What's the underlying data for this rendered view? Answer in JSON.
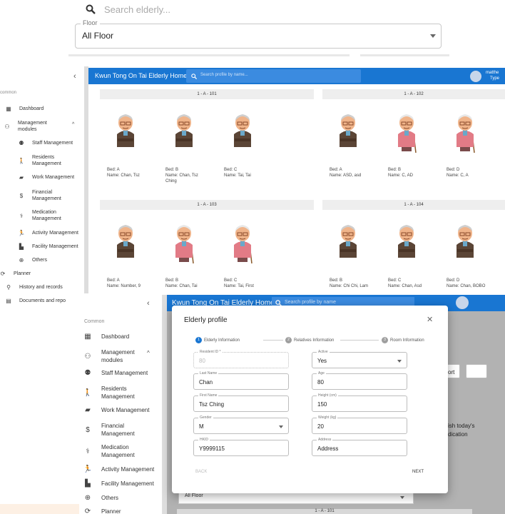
{
  "panel1": {
    "search_placeholder": "Search elderly...",
    "floor_label": "Floor",
    "floor_value": "All Floor"
  },
  "panel2": {
    "collapse_icon": "chevron-left-icon",
    "section_label": "common",
    "sidebar": [
      {
        "icon": "dashboard-icon",
        "glyph": "▦",
        "label": "Dashboard"
      },
      {
        "icon": "people-icon",
        "glyph": "⚇",
        "label": "Management\nmodules",
        "expand": "^"
      },
      {
        "icon": "staff-icon",
        "glyph": "⚉",
        "label": "Staff Management"
      },
      {
        "icon": "walking-icon",
        "glyph": "🚶",
        "label": "Residents\nManagement"
      },
      {
        "icon": "briefcase-icon",
        "glyph": "▰",
        "label": "Work Management"
      },
      {
        "icon": "dollar-icon",
        "glyph": "$",
        "label": "Financial\nManagement"
      },
      {
        "icon": "pills-icon",
        "glyph": "⚕",
        "label": "Medication\nManagement"
      },
      {
        "icon": "running-icon",
        "glyph": "🏃",
        "label": "Activity Management"
      },
      {
        "icon": "building-icon",
        "glyph": "▙",
        "label": "Facility Management"
      },
      {
        "icon": "plus-circle-icon",
        "glyph": "⊕",
        "label": "Others"
      },
      {
        "icon": "planner-icon",
        "glyph": "⟳",
        "label": "Planner"
      },
      {
        "icon": "history-icon",
        "glyph": "⚲",
        "label": "History and records"
      },
      {
        "icon": "documents-icon",
        "glyph": "▤",
        "label": "Documents and repo"
      }
    ],
    "app_title": "Kwun Tong On Tai Elderly Home",
    "search_placeholder": "Search profile by name...",
    "user_name": "matthe",
    "user_type": "Type",
    "rooms": [
      {
        "name": "1 - A - 101",
        "residents": [
          {
            "bed": "Bed: A",
            "name": "Name: Chan, Tsz",
            "gender": "m"
          },
          {
            "bed": "Bed: B",
            "name": "Name: Chan, Tsz\nChing",
            "gender": "m"
          },
          {
            "bed": "Bed: C",
            "name": "Name: Tai, Tai",
            "gender": "m"
          }
        ]
      },
      {
        "name": "1 - A - 102",
        "residents": [
          {
            "bed": "Bed: A",
            "name": "Name: ASD, asd",
            "gender": "m"
          },
          {
            "bed": "Bed: B",
            "name": "Name: C, AD",
            "gender": "f"
          },
          {
            "bed": "Bed: D",
            "name": "Name: C, A",
            "gender": "f"
          }
        ]
      },
      {
        "name": "1 - A - 103",
        "residents": [
          {
            "bed": "Bed: A",
            "name": "Name: Number, 9",
            "gender": "m"
          },
          {
            "bed": "Bed: B",
            "name": "Name: Chan, Tai",
            "gender": "f"
          },
          {
            "bed": "Bed: C",
            "name": "Name: Tai, First",
            "gender": "f"
          }
        ]
      },
      {
        "name": "1 - A - 104",
        "residents": [
          {
            "bed": "Bed: B",
            "name": "Name: Chi Chi, Lam",
            "gender": "m"
          },
          {
            "bed": "Bed: C",
            "name": "Name: Chan, Asd",
            "gender": "m"
          },
          {
            "bed": "Bed: D",
            "name": "Name: Chan, BOBO",
            "gender": "m"
          }
        ]
      }
    ]
  },
  "panel3": {
    "section_label": "Common",
    "sidebar": [
      {
        "icon": "dashboard-icon",
        "glyph": "▦",
        "label": "Dashboard"
      },
      {
        "icon": "people-icon",
        "glyph": "⚇",
        "label": "Management\nmodules",
        "expand": "^"
      },
      {
        "icon": "staff-icon",
        "glyph": "⚉",
        "label": "Staff Management"
      },
      {
        "icon": "walking-icon",
        "glyph": "🚶",
        "label": "Residents\nManagement"
      },
      {
        "icon": "briefcase-icon",
        "glyph": "▰",
        "label": "Work Management"
      },
      {
        "icon": "dollar-icon",
        "glyph": "$",
        "label": "Financial\nManagement"
      },
      {
        "icon": "pills-icon",
        "glyph": "⚕",
        "label": "Medication\nManagement"
      },
      {
        "icon": "running-icon",
        "glyph": "🏃",
        "label": "Activity Management"
      },
      {
        "icon": "building-icon",
        "glyph": "▙",
        "label": "Facility Management"
      },
      {
        "icon": "plus-circle-icon",
        "glyph": "⊕",
        "label": "Others"
      },
      {
        "icon": "planner-icon",
        "glyph": "⟳",
        "label": "Planner"
      }
    ],
    "app_title": "Kwun Tong On Tai Elderly Home",
    "search_placeholder": "Search profile by name",
    "background_snippets": [
      "ort",
      "ish today's",
      "dication"
    ],
    "background_floor": "All Floor",
    "background_room": "1 - A - 101",
    "modal": {
      "title": "Elderly profile",
      "steps": [
        {
          "num": "1",
          "label": "Elderly Information",
          "active": true
        },
        {
          "num": "2",
          "label": "Relatives Information",
          "active": false
        },
        {
          "num": "3",
          "label": "Room Information",
          "active": false
        }
      ],
      "fields_left": [
        {
          "label": "Resident ID *",
          "value": "80",
          "disabled": true
        },
        {
          "label": "Last Name",
          "value": "Chan"
        },
        {
          "label": "First Name",
          "value": "Tsz Ching"
        },
        {
          "label": "Gender",
          "value": "M",
          "select": true
        },
        {
          "label": "HKID",
          "value": "Y9999115"
        }
      ],
      "fields_right": [
        {
          "label": "Active",
          "value": "Yes",
          "select": true
        },
        {
          "label": "Age",
          "value": "80"
        },
        {
          "label": "Height (cm)",
          "value": "150"
        },
        {
          "label": "Weight (kg)",
          "value": "20"
        },
        {
          "label": "Address",
          "value": "Address"
        }
      ],
      "back_label": "BACK",
      "next_label": "NEXT"
    }
  },
  "colors": {
    "primary": "#1976d2",
    "elder_male_sweater": "#5b4536",
    "elder_female_cardigan": "#e27b86"
  }
}
